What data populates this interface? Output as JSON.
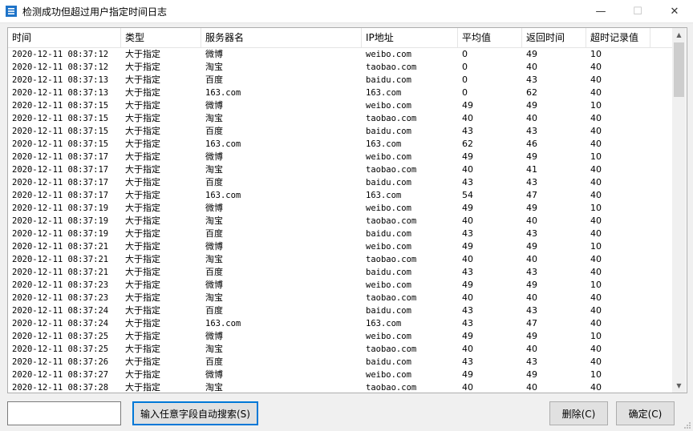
{
  "window": {
    "title": "检测成功但超过用户指定时间日志",
    "minimize_glyph": "—",
    "maximize_glyph": "☐",
    "close_glyph": "✕",
    "icon": "app-list-icon"
  },
  "table": {
    "columns": [
      "时间",
      "类型",
      "服务器名",
      "IP地址",
      "平均值",
      "返回时间",
      "超时记录值",
      ""
    ],
    "rows": [
      [
        "2020-12-11 08:37:12",
        "大于指定",
        "微博",
        "weibo.com",
        "0",
        "49",
        "10"
      ],
      [
        "2020-12-11 08:37:12",
        "大于指定",
        "淘宝",
        "taobao.com",
        "0",
        "40",
        "40"
      ],
      [
        "2020-12-11 08:37:13",
        "大于指定",
        "百度",
        "baidu.com",
        "0",
        "43",
        "40"
      ],
      [
        "2020-12-11 08:37:13",
        "大于指定",
        "163.com",
        "163.com",
        "0",
        "62",
        "40"
      ],
      [
        "2020-12-11 08:37:15",
        "大于指定",
        "微博",
        "weibo.com",
        "49",
        "49",
        "10"
      ],
      [
        "2020-12-11 08:37:15",
        "大于指定",
        "淘宝",
        "taobao.com",
        "40",
        "40",
        "40"
      ],
      [
        "2020-12-11 08:37:15",
        "大于指定",
        "百度",
        "baidu.com",
        "43",
        "43",
        "40"
      ],
      [
        "2020-12-11 08:37:15",
        "大于指定",
        "163.com",
        "163.com",
        "62",
        "46",
        "40"
      ],
      [
        "2020-12-11 08:37:17",
        "大于指定",
        "微博",
        "weibo.com",
        "49",
        "49",
        "10"
      ],
      [
        "2020-12-11 08:37:17",
        "大于指定",
        "淘宝",
        "taobao.com",
        "40",
        "41",
        "40"
      ],
      [
        "2020-12-11 08:37:17",
        "大于指定",
        "百度",
        "baidu.com",
        "43",
        "43",
        "40"
      ],
      [
        "2020-12-11 08:37:17",
        "大于指定",
        "163.com",
        "163.com",
        "54",
        "47",
        "40"
      ],
      [
        "2020-12-11 08:37:19",
        "大于指定",
        "微博",
        "weibo.com",
        "49",
        "49",
        "10"
      ],
      [
        "2020-12-11 08:37:19",
        "大于指定",
        "淘宝",
        "taobao.com",
        "40",
        "40",
        "40"
      ],
      [
        "2020-12-11 08:37:19",
        "大于指定",
        "百度",
        "baidu.com",
        "43",
        "43",
        "40"
      ],
      [
        "2020-12-11 08:37:21",
        "大于指定",
        "微博",
        "weibo.com",
        "49",
        "49",
        "10"
      ],
      [
        "2020-12-11 08:37:21",
        "大于指定",
        "淘宝",
        "taobao.com",
        "40",
        "40",
        "40"
      ],
      [
        "2020-12-11 08:37:21",
        "大于指定",
        "百度",
        "baidu.com",
        "43",
        "43",
        "40"
      ],
      [
        "2020-12-11 08:37:23",
        "大于指定",
        "微博",
        "weibo.com",
        "49",
        "49",
        "10"
      ],
      [
        "2020-12-11 08:37:23",
        "大于指定",
        "淘宝",
        "taobao.com",
        "40",
        "40",
        "40"
      ],
      [
        "2020-12-11 08:37:24",
        "大于指定",
        "百度",
        "baidu.com",
        "43",
        "43",
        "40"
      ],
      [
        "2020-12-11 08:37:24",
        "大于指定",
        "163.com",
        "163.com",
        "43",
        "47",
        "40"
      ],
      [
        "2020-12-11 08:37:25",
        "大于指定",
        "微博",
        "weibo.com",
        "49",
        "49",
        "10"
      ],
      [
        "2020-12-11 08:37:25",
        "大于指定",
        "淘宝",
        "taobao.com",
        "40",
        "40",
        "40"
      ],
      [
        "2020-12-11 08:37:26",
        "大于指定",
        "百度",
        "baidu.com",
        "43",
        "43",
        "40"
      ],
      [
        "2020-12-11 08:37:27",
        "大于指定",
        "微博",
        "weibo.com",
        "49",
        "49",
        "10"
      ],
      [
        "2020-12-11 08:37:28",
        "大于指定",
        "淘宝",
        "taobao.com",
        "40",
        "40",
        "40"
      ]
    ]
  },
  "footer": {
    "search_value": "",
    "search_button": "输入任意字段自动搜索(S)",
    "delete_button": "删除(C)",
    "ok_button": "确定(C)"
  },
  "colors": {
    "focus_border": "#0078d7",
    "window_bg": "#f0f0f0"
  }
}
